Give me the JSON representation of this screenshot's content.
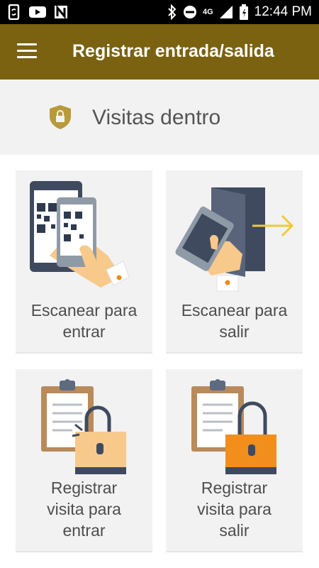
{
  "status_bar": {
    "time": "12:44 PM",
    "network": "4G",
    "icons": [
      "sync-phone-icon",
      "youtube-icon",
      "n-app-icon",
      "bluetooth-icon",
      "do-not-disturb-icon",
      "signal-icon",
      "battery-icon"
    ]
  },
  "app_bar": {
    "title": "Registrar entrada/salida",
    "menu_icon": "hamburger-menu-icon",
    "background": "#7a6211"
  },
  "visitas": {
    "label": "Visitas dentro",
    "icon": "shield-lock-icon",
    "icon_color": "#b99a3a"
  },
  "cards": [
    {
      "label_lines": [
        "Escanear para",
        "entrar"
      ],
      "icon": "qr-scan-enter-icon"
    },
    {
      "label_lines": [
        "Escanear para",
        "salir"
      ],
      "icon": "qr-scan-exit-icon"
    },
    {
      "label_lines": [
        "Registrar",
        "visita para",
        "entrar"
      ],
      "icon": "register-visit-enter-icon"
    },
    {
      "label_lines": [
        "Registrar",
        "visita para",
        "salir"
      ],
      "icon": "register-visit-exit-icon"
    }
  ]
}
